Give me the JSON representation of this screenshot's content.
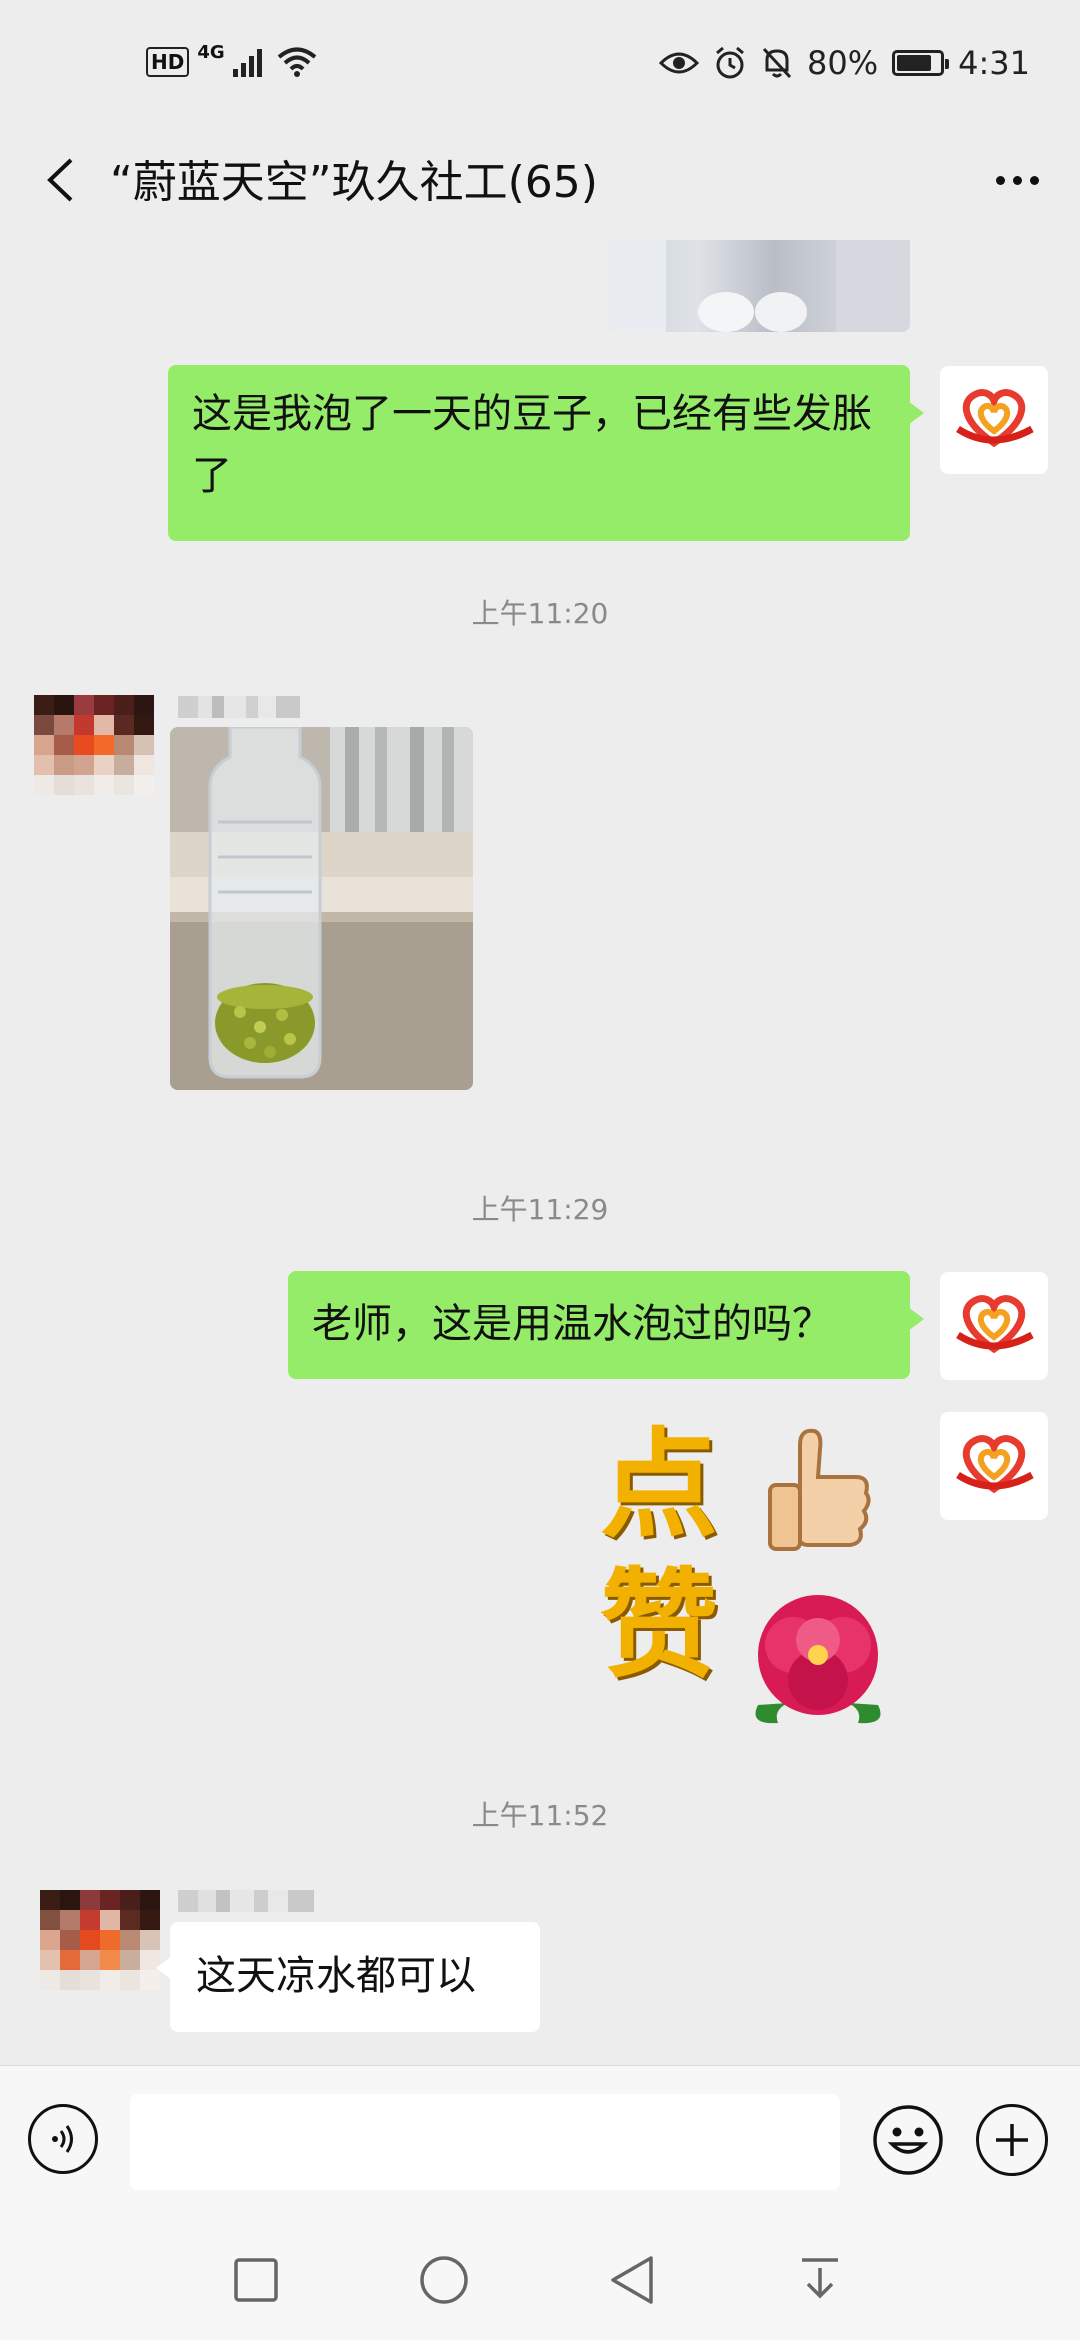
{
  "status_bar": {
    "network_badge": "HD",
    "network_type": "4G",
    "battery": "80%",
    "battery_level": 0.8,
    "time": "4:31",
    "icons": [
      "signal-icon",
      "wifi-icon",
      "eye-icon",
      "alarm-icon",
      "mute-icon",
      "battery-icon"
    ]
  },
  "header": {
    "title": "“蔚蓝天空”玖久社工(65)",
    "back_icon": "chevron-left-icon",
    "more_icon": "more-icon"
  },
  "messages": [
    {
      "type": "image",
      "side": "right",
      "description_icon": "photo-thumbnail"
    },
    {
      "type": "text",
      "side": "right",
      "text": "这是我泡了一天的豆子，已经有些发胀了"
    },
    {
      "type": "time",
      "text": "上午11:20"
    },
    {
      "type": "image",
      "side": "left",
      "description_icon": "photo-bottle-beans"
    },
    {
      "type": "time",
      "text": "上午11:29"
    },
    {
      "type": "text",
      "side": "right",
      "text": "老师，这是用温水泡过的吗？"
    },
    {
      "type": "sticker",
      "side": "right",
      "text": "点赞"
    },
    {
      "type": "time",
      "text": "上午11:52"
    },
    {
      "type": "text",
      "side": "left",
      "text": "这天凉水都可以"
    }
  ],
  "input_bar": {
    "voice_icon": "voice-icon",
    "emoji_icon": "emoji-icon",
    "plus_icon": "plus-icon"
  },
  "system_nav": [
    "recent-apps-icon",
    "home-icon",
    "back-icon",
    "notification-pull-icon"
  ],
  "colors": {
    "background": "#ededed",
    "self_bubble": "#95ec69",
    "other_bubble": "#ffffff",
    "timestamp": "#8a8a8a"
  }
}
